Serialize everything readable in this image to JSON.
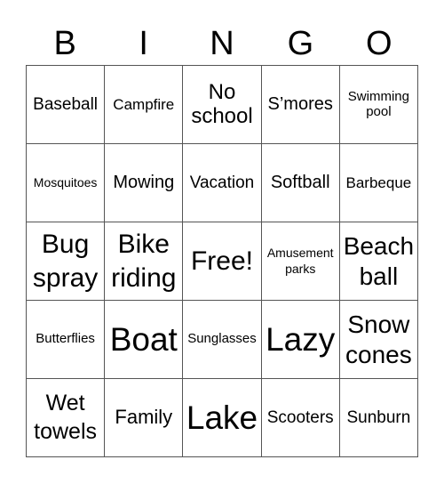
{
  "header": [
    "B",
    "I",
    "N",
    "G",
    "O"
  ],
  "cells": [
    [
      "Baseball",
      "Campfire",
      "No school",
      "S’mores",
      "Swimming pool"
    ],
    [
      "Mosquitoes",
      "Mowing",
      "Vacation",
      "Softball",
      "Barbeque"
    ],
    [
      "Bug spray",
      "Bike riding",
      "Free!",
      "Amusement parks",
      "Beach ball"
    ],
    [
      "Butterflies",
      "Boat",
      "Sunglasses",
      "Lazy",
      "Snow cones"
    ],
    [
      "Wet towels",
      "Family",
      "Lake",
      "Scooters",
      "Sunburn"
    ]
  ]
}
